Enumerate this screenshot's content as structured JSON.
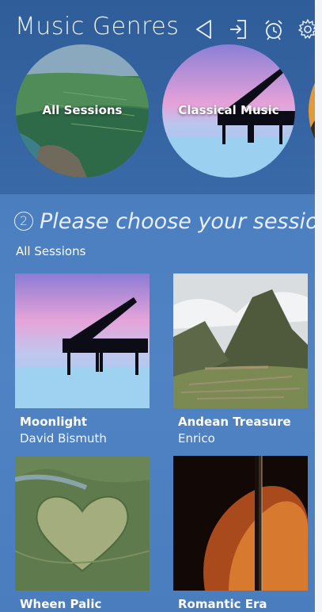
{
  "header": {
    "title": "Music Genres",
    "icons": [
      "back-icon",
      "login-icon",
      "alarm-icon",
      "gear-icon"
    ]
  },
  "genres": [
    {
      "label": "All Sessions"
    },
    {
      "label": "Classical Music"
    }
  ],
  "section": {
    "step": "2",
    "heading": "Please choose your session",
    "subtitle": "All Sessions"
  },
  "sessions": [
    {
      "name": "Moonlight",
      "artist": "David Bismuth"
    },
    {
      "name": "Andean Treasure",
      "artist": "Enrico"
    },
    {
      "name": "Wheen Palic",
      "artist": ""
    },
    {
      "name": "Romantic Era",
      "artist": ""
    }
  ],
  "colors": {
    "background": "#4a7dbe",
    "header": "#2f5d99",
    "text": "#ffffff"
  }
}
